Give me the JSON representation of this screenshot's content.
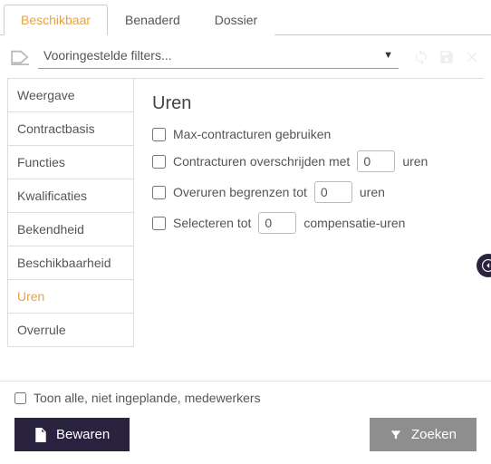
{
  "tabs": [
    {
      "label": "Beschikbaar",
      "active": true
    },
    {
      "label": "Benaderd",
      "active": false
    },
    {
      "label": "Dossier",
      "active": false
    }
  ],
  "filter": {
    "placeholder": "Vooringestelde filters..."
  },
  "sidenav": [
    "Weergave",
    "Contractbasis",
    "Functies",
    "Kwalificaties",
    "Bekendheid",
    "Beschikbaarheid",
    "Uren",
    "Overrule"
  ],
  "sidenav_active_index": 6,
  "content": {
    "heading": "Uren",
    "opt_max_contract": "Max-contracturen gebruiken",
    "opt_exceed_prefix": "Contracturen overschrijden met",
    "opt_exceed_value": "0",
    "opt_exceed_suffix": "uren",
    "opt_overtime_prefix": "Overuren begrenzen tot",
    "opt_overtime_value": "0",
    "opt_overtime_suffix": "uren",
    "opt_select_prefix": "Selecteren tot",
    "opt_select_value": "0",
    "opt_select_suffix": "compensatie-uren"
  },
  "footer": {
    "show_all": "Toon alle, niet ingeplande, medewerkers",
    "save": "Bewaren",
    "search": "Zoeken"
  }
}
